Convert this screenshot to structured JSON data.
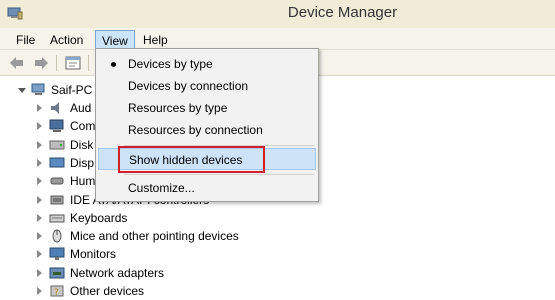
{
  "window": {
    "title": "Device Manager"
  },
  "menubar": {
    "items": [
      "File",
      "Action",
      "View",
      "Help"
    ]
  },
  "view_menu": {
    "items": [
      {
        "label": "Devices by type",
        "checked": true
      },
      {
        "label": "Devices by connection",
        "checked": false
      },
      {
        "label": "Resources by type",
        "checked": false
      },
      {
        "label": "Resources by connection",
        "checked": false
      },
      {
        "label": "Show hidden devices",
        "highlighted": true
      },
      {
        "label": "Customize...",
        "checked": false
      }
    ]
  },
  "tree": {
    "root": "Saif-PC",
    "nodes": [
      {
        "label": "Aud",
        "icon": "audio-icon"
      },
      {
        "label": "Com",
        "icon": "computer-icon"
      },
      {
        "label": "Disk",
        "icon": "disk-icon"
      },
      {
        "label": "Disp",
        "icon": "display-icon"
      },
      {
        "label": "Hum",
        "icon": "hid-icon"
      },
      {
        "label": "IDE ATA/ATAPI controllers",
        "icon": "ide-icon"
      },
      {
        "label": "Keyboards",
        "icon": "keyboard-icon"
      },
      {
        "label": "Mice and other pointing devices",
        "icon": "mouse-icon"
      },
      {
        "label": "Monitors",
        "icon": "monitor-icon"
      },
      {
        "label": "Network adapters",
        "icon": "network-icon"
      },
      {
        "label": "Other devices",
        "icon": "other-devices-icon"
      }
    ]
  },
  "colors": {
    "highlight_border": "#d0202a",
    "menu_open_bg": "#cce4f7",
    "selected_item_bg": "#cfe3f8"
  }
}
